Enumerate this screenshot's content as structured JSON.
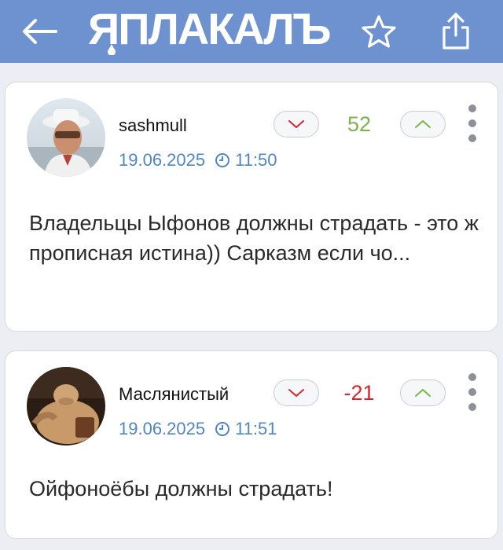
{
  "header": {
    "logo_text": "ЯПЛАКАЛЪ",
    "background": "#6d92cf",
    "icons": [
      "back-arrow-icon",
      "star-icon",
      "share-icon"
    ]
  },
  "comments": [
    {
      "author": "sashmull",
      "date": "19.06.2025",
      "time": "11:50",
      "score": "52",
      "score_color": "#79b54a",
      "text": "Владельцы Ыфонов должны страдать - это ж прописная истина)) Сарказм если чо..."
    },
    {
      "author": "Маслянистый",
      "date": "19.06.2025",
      "time": "11:51",
      "score": "-21",
      "score_color": "#d9242a",
      "text": "Ойфоноёбы должны страдать!"
    }
  ],
  "colors": {
    "link_blue": "#4f86c6",
    "page_bg": "#eceef3"
  }
}
